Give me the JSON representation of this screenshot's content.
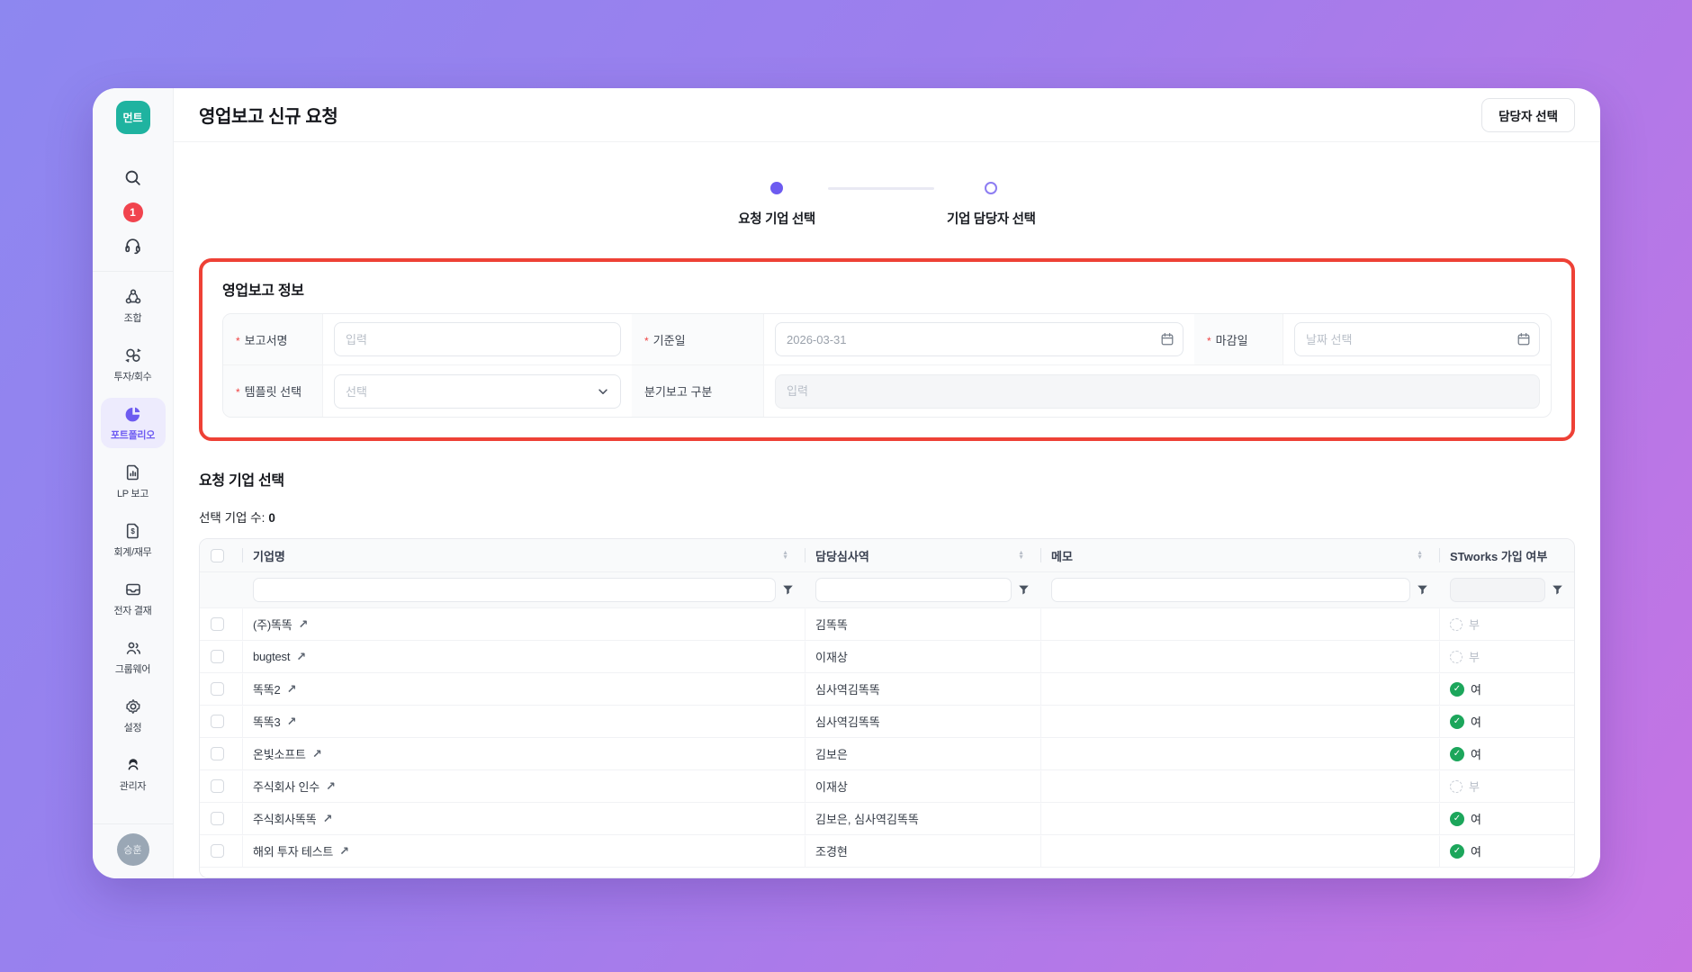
{
  "colors": {
    "accent_purple": "#6d5bf0",
    "highlight_red": "#ee4136",
    "logo_teal": "#1fb3a0",
    "status_green": "#1ca65b",
    "badge_red": "#f1444e",
    "background_gradient": [
      "#8d87f0",
      "#c673e3"
    ]
  },
  "sidebar": {
    "logo_text": "먼트",
    "notification_count": "1",
    "items": [
      {
        "label": "조합",
        "active": false
      },
      {
        "label": "투자/회수",
        "active": false
      },
      {
        "label": "포트폴리오",
        "active": true
      },
      {
        "label": "LP 보고",
        "active": false
      },
      {
        "label": "회계/재무",
        "active": false
      },
      {
        "label": "전자 결재",
        "active": false
      },
      {
        "label": "그룹웨어",
        "active": false
      },
      {
        "label": "설정",
        "active": false
      },
      {
        "label": "관리자",
        "active": false
      }
    ],
    "avatar_label": "승훈"
  },
  "header": {
    "title": "영업보고 신규 요청",
    "action_button": "담당자 선택"
  },
  "stepper": {
    "steps": [
      {
        "label": "요청 기업 선택",
        "state": "active"
      },
      {
        "label": "기업 담당자 선택",
        "state": "upcoming"
      }
    ]
  },
  "report_info": {
    "title": "영업보고 정보",
    "fields": {
      "report_name": {
        "label": "보고서명",
        "required": true,
        "placeholder": "입력"
      },
      "base_date": {
        "label": "기준일",
        "required": true,
        "value": "2026-03-31"
      },
      "due_date": {
        "label": "마감일",
        "required": true,
        "placeholder": "날짜 선택"
      },
      "template": {
        "label": "템플릿 선택",
        "required": true,
        "placeholder": "선택"
      },
      "quarter_type": {
        "label": "분기보고 구분",
        "required": false,
        "placeholder": "입력"
      }
    }
  },
  "company_select": {
    "title": "요청 기업 선택",
    "selected_count_label": "선택 기업 수:",
    "selected_count": "0",
    "table": {
      "columns": [
        "기업명",
        "담당심사역",
        "메모",
        "STworks 가입 여부"
      ],
      "rows": [
        {
          "company": "(주)똑똑",
          "reviewer": "김똑똑",
          "memo": "",
          "stworks": {
            "label": "부",
            "joined": false
          }
        },
        {
          "company": "bugtest",
          "reviewer": "이재상",
          "memo": "",
          "stworks": {
            "label": "부",
            "joined": false
          }
        },
        {
          "company": "똑똑2",
          "reviewer": "심사역김똑똑",
          "memo": "",
          "stworks": {
            "label": "여",
            "joined": true
          }
        },
        {
          "company": "똑똑3",
          "reviewer": "심사역김똑똑",
          "memo": "",
          "stworks": {
            "label": "여",
            "joined": true
          }
        },
        {
          "company": "온빛소프트",
          "reviewer": "김보은",
          "memo": "",
          "stworks": {
            "label": "여",
            "joined": true
          }
        },
        {
          "company": "주식회사 인수",
          "reviewer": "이재상",
          "memo": "",
          "stworks": {
            "label": "부",
            "joined": false
          }
        },
        {
          "company": "주식회사똑똑",
          "reviewer": "김보은, 심사역김똑똑",
          "memo": "",
          "stworks": {
            "label": "여",
            "joined": true
          }
        },
        {
          "company": "해외 투자 테스트",
          "reviewer": "조경현",
          "memo": "",
          "stworks": {
            "label": "여",
            "joined": true
          }
        }
      ]
    }
  }
}
